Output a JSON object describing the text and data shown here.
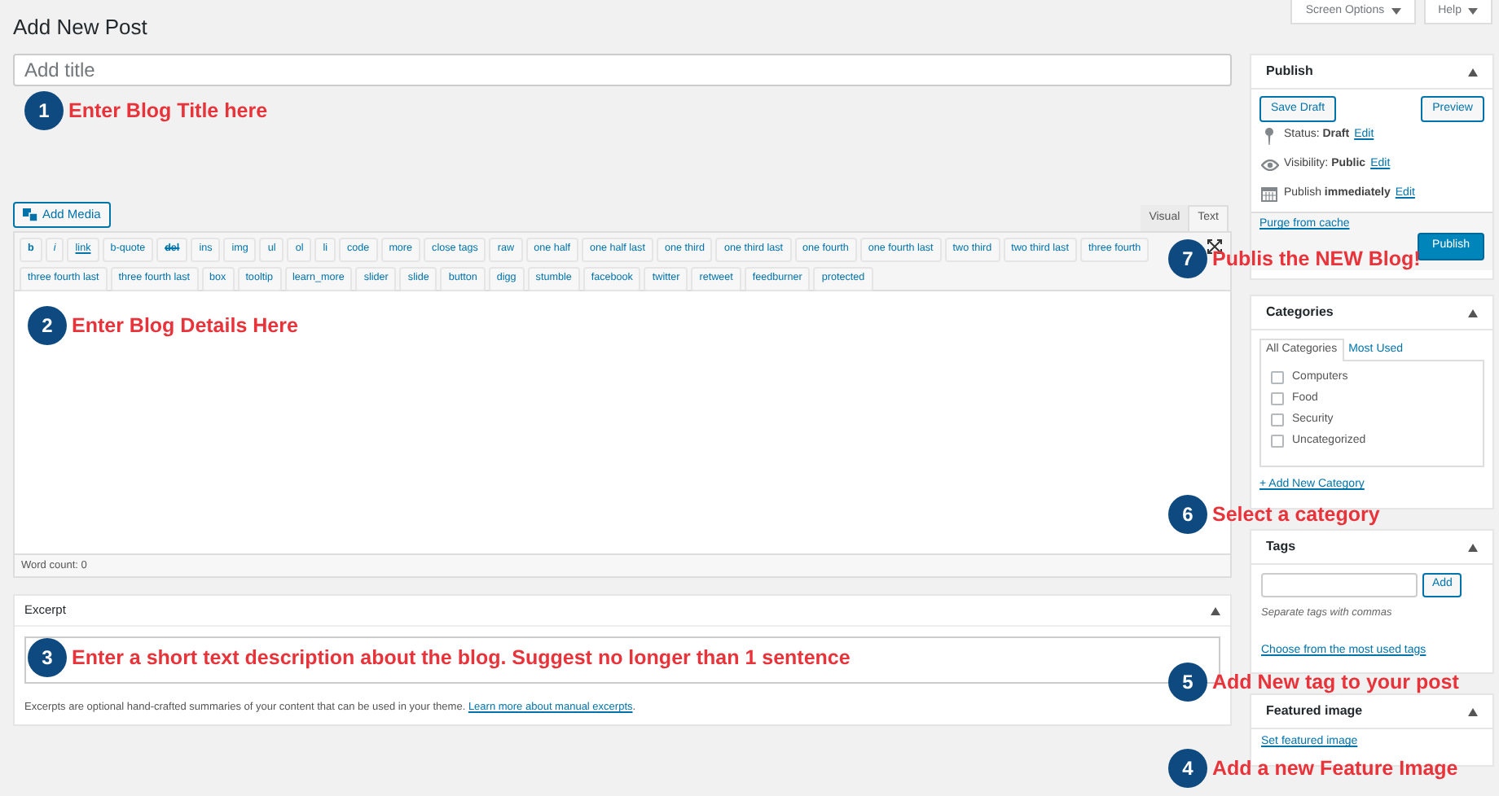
{
  "header": {
    "title": "Add New Post",
    "buttons": [
      "Screen Options",
      "Help"
    ]
  },
  "title_field": {
    "placeholder": "Add title"
  },
  "editor": {
    "add_media": "Add Media",
    "tabs": [
      {
        "label": "Visual",
        "selected": false
      },
      {
        "label": "Text",
        "selected": true
      }
    ],
    "quicktags_row_1": [
      {
        "label": "b",
        "kind": "bold"
      },
      {
        "label": "i",
        "kind": "italic"
      },
      {
        "label": "link",
        "kind": "underline"
      },
      {
        "label": "b-quote",
        "kind": "plain"
      },
      {
        "label": "del",
        "kind": "strike"
      },
      {
        "label": "ins",
        "kind": "plain"
      },
      {
        "label": "img",
        "kind": "plain"
      },
      {
        "label": "ul",
        "kind": "plain"
      },
      {
        "label": "ol",
        "kind": "plain"
      },
      {
        "label": "li",
        "kind": "plain"
      },
      {
        "label": "code",
        "kind": "plain"
      },
      {
        "label": "more",
        "kind": "plain"
      },
      {
        "label": "close tags",
        "kind": "plain"
      },
      {
        "label": "raw",
        "kind": "plain"
      },
      {
        "label": "one half",
        "kind": "plain"
      },
      {
        "label": "one half last",
        "kind": "plain"
      },
      {
        "label": "one third",
        "kind": "plain"
      },
      {
        "label": "one third last",
        "kind": "plain"
      },
      {
        "label": "one fourth",
        "kind": "plain"
      },
      {
        "label": "one fourth last",
        "kind": "plain"
      },
      {
        "label": "two third",
        "kind": "plain"
      },
      {
        "label": "two third last",
        "kind": "plain"
      },
      {
        "label": "three fourth",
        "kind": "plain"
      }
    ],
    "quicktags_row_2": [
      {
        "label": "three fourth last",
        "kind": "plain"
      },
      {
        "label": "three fourth last",
        "kind": "plain"
      },
      {
        "label": "box",
        "kind": "plain"
      },
      {
        "label": "tooltip",
        "kind": "plain"
      },
      {
        "label": "learn_more",
        "kind": "plain"
      },
      {
        "label": "slider",
        "kind": "plain"
      },
      {
        "label": "slide",
        "kind": "plain"
      },
      {
        "label": "button",
        "kind": "plain"
      },
      {
        "label": "digg",
        "kind": "plain"
      },
      {
        "label": "stumble",
        "kind": "plain"
      },
      {
        "label": "facebook",
        "kind": "plain"
      },
      {
        "label": "twitter",
        "kind": "plain"
      },
      {
        "label": "retweet",
        "kind": "plain"
      },
      {
        "label": "feedburner",
        "kind": "plain"
      },
      {
        "label": "protected",
        "kind": "plain"
      }
    ],
    "word_count": "Word count: 0"
  },
  "excerpt": {
    "title": "Excerpt",
    "note": "Excerpts are optional hand-crafted summaries of your content that can be used in your theme.",
    "link": "Learn more about manual excerpts",
    "note_end": "."
  },
  "publish": {
    "title": "Publish",
    "save_draft": "Save Draft",
    "preview": "Preview",
    "rows": [
      {
        "label": "Status:",
        "value": "Draft",
        "link": "Edit",
        "kind": "pin"
      },
      {
        "label": "Visibility:",
        "value": "Public",
        "link": "Edit",
        "kind": "eye"
      },
      {
        "label": "Publish",
        "value": "immediately",
        "link": "Edit",
        "kind": "calendar"
      }
    ],
    "purge": "Purge from cache",
    "publish_button": "Publish"
  },
  "categories": {
    "title": "Categories",
    "tabs": [
      {
        "label": "All Categories",
        "selected": true
      },
      {
        "label": "Most Used",
        "selected": false
      }
    ],
    "items": [
      {
        "label": "Computers",
        "checked": false
      },
      {
        "label": "Food",
        "checked": false
      },
      {
        "label": "Security",
        "checked": false
      },
      {
        "label": "Uncategorized",
        "checked": false
      }
    ],
    "add_new": "+ Add New Category"
  },
  "tags": {
    "title": "Tags",
    "add": "Add",
    "hint": "Separate tags with commas",
    "choose": "Choose from the most used tags"
  },
  "featured_image": {
    "title": "Featured image",
    "link": "Set featured image"
  },
  "annotations": [
    {
      "number": "1",
      "text": "Enter Blog Title here"
    },
    {
      "number": "2",
      "text": "Enter Blog Details Here"
    },
    {
      "number": "3",
      "text": "Enter a short text description about the blog. Suggest no longer than 1 sentence"
    },
    {
      "number": "7",
      "text": "Publis the NEW Blog!"
    },
    {
      "number": "6",
      "text": "Select a category"
    },
    {
      "number": "5",
      "text": "Add New tag to your post"
    },
    {
      "number": "4",
      "text": "Add a new Feature Image"
    }
  ]
}
